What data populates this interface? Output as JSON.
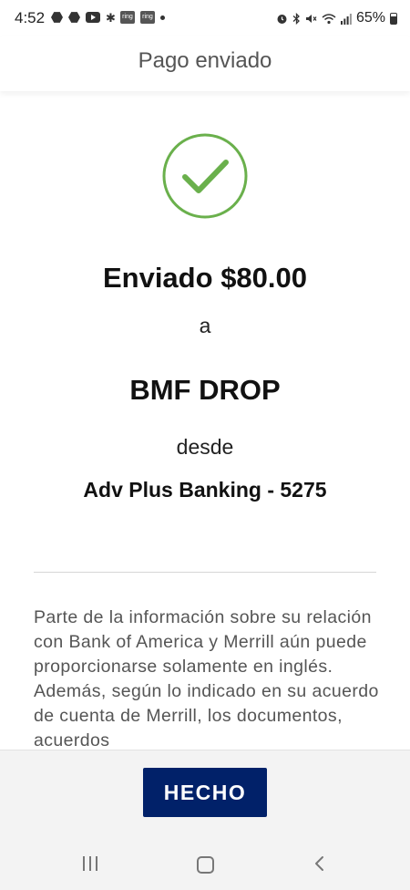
{
  "status_bar": {
    "time": "4:52",
    "ring_label": "ring",
    "battery": "65%",
    "icons": [
      "app-icon",
      "app-icon",
      "youtube-icon",
      "bluetooth-icon",
      "ring-icon",
      "ring-icon",
      "dot-icon",
      "alarm-icon",
      "bluetooth-icon",
      "mute-icon",
      "wifi-icon",
      "signal-icon",
      "battery-icon"
    ]
  },
  "header": {
    "title": "Pago enviado"
  },
  "confirmation": {
    "sent_label": "Enviado",
    "amount": "$80.00",
    "to_word": "a",
    "recipient": "BMF DROP",
    "from_word": "desde",
    "account": "Adv Plus Banking - 5275",
    "success_color": "#6ab04c"
  },
  "disclaimer": {
    "text": "Parte de la información sobre su relación con Bank of America y Merrill aún puede proporcionarse solamente en inglés. Además, según lo indicado en su acuerdo de cuenta de Merrill, los documentos, acuerdos"
  },
  "footer": {
    "done_label": "HECHO",
    "button_color": "#012169"
  },
  "nav_bar": {
    "icons": [
      "recents-icon",
      "home-icon",
      "back-icon"
    ]
  }
}
